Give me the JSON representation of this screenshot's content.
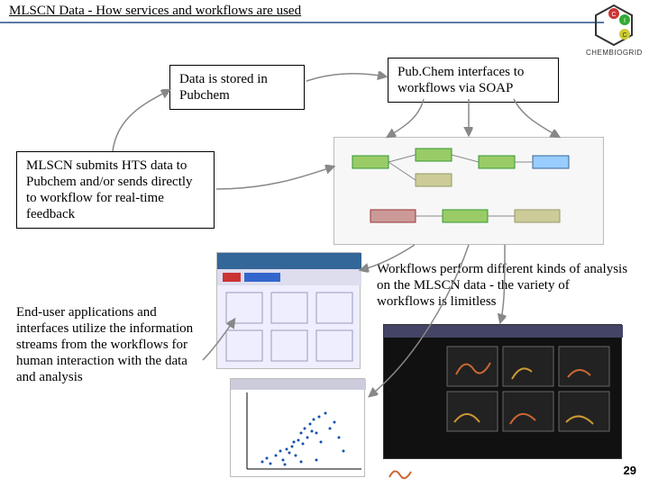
{
  "title": "MLSCN Data - How services and workflows are used",
  "logo": {
    "brand": "CHEMBIOGRID"
  },
  "boxes": {
    "stored": "Data is stored in Pubchem",
    "pubchem_soap": "Pub.Chem interfaces to workflows via SOAP",
    "mlscn_submit": "MLSCN submits HTS data to Pubchem and/or sends directly to workflow for real-time feedback",
    "workflows_analysis": "Workflows perform different kinds of analysis on the MLSCN data - the variety of workflows is limitless",
    "end_user": "End-user applications and interfaces utilize the information streams from the workflows for human interaction with the data and analysis"
  },
  "page_number": "29"
}
